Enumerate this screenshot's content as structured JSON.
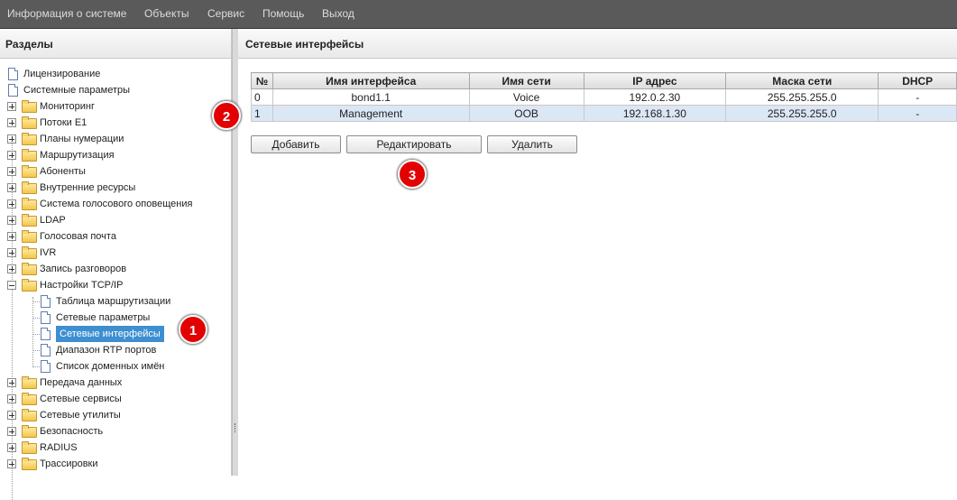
{
  "menu": [
    "Информация о системе",
    "Объекты",
    "Сервис",
    "Помощь",
    "Выход"
  ],
  "left_panel": {
    "title": "Разделы"
  },
  "right_panel": {
    "title": "Сетевые интерфейсы"
  },
  "tree": {
    "top_docs": [
      "Лицензирование",
      "Системные параметры"
    ],
    "folders_a": [
      "Мониторинг",
      "Потоки Е1",
      "Планы нумерации",
      "Маршрутизация",
      "Абоненты",
      "Внутренние ресурсы",
      "Система голосового оповещения",
      "LDAP",
      "Голосовая почта",
      "IVR",
      "Запись разговоров"
    ],
    "expanded": "Настройки TCP/IP",
    "children": [
      "Таблица маршрутизации",
      "Сетевые параметры",
      "Сетевые интерфейсы",
      "Диапазон RTP портов",
      "Список доменных имён"
    ],
    "folders_b": [
      "Передача данных",
      "Сетевые сервисы",
      "Сетевые утилиты",
      "Безопасность",
      "RADIUS",
      "Трассировки"
    ]
  },
  "table": {
    "headers": [
      "№",
      "Имя интерфейса",
      "Имя сети",
      "IP адрес",
      "Маска сети",
      "DHCP"
    ],
    "rows": [
      [
        "0",
        "bond1.1",
        "Voice",
        "192.0.2.30",
        "255.255.255.0",
        "-"
      ],
      [
        "1",
        "Management",
        "OOB",
        "192.168.1.30",
        "255.255.255.0",
        "-"
      ]
    ]
  },
  "buttons": {
    "add": "Добавить",
    "edit": "Редактировать",
    "delete": "Удалить"
  },
  "markers": [
    "1",
    "2",
    "3"
  ],
  "colors": {
    "menubar": "#5a5a5a",
    "selection": "#3d8fd1",
    "marker": "#e20000",
    "selected_row": "#dce7f6"
  }
}
